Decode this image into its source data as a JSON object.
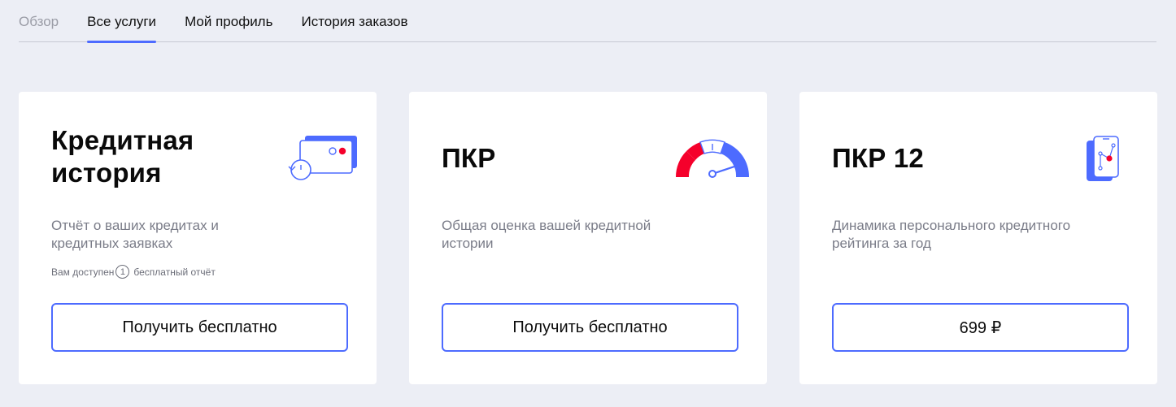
{
  "tabs": [
    {
      "label": "Обзор",
      "state": "muted"
    },
    {
      "label": "Все услуги",
      "state": "active"
    },
    {
      "label": "Мой профиль",
      "state": "normal"
    },
    {
      "label": "История заказов",
      "state": "normal"
    }
  ],
  "cards": [
    {
      "title_line1": "Кредитная",
      "title_line2": "история",
      "description": "Отчёт о ваших кредитах и кредитных заявках",
      "note_prefix": "Вам доступен",
      "note_count": "1",
      "note_suffix": "бесплатный отчёт",
      "button_label": "Получить бесплатно",
      "icon": "credit-cards-history-icon"
    },
    {
      "title": "ПКР",
      "description": "Общая оценка вашей кредитной истории",
      "button_label": "Получить бесплатно",
      "icon": "speedometer-icon"
    },
    {
      "title": "ПКР 12",
      "description": "Динамика персонального кредитного рейтинга за год",
      "button_label": "699 ₽",
      "icon": "phone-chart-icon"
    }
  ],
  "colors": {
    "accent": "#4d6bff",
    "danger": "#f5002b",
    "background": "#eceef5",
    "card": "#ffffff",
    "muted_text": "#7a7c88"
  }
}
